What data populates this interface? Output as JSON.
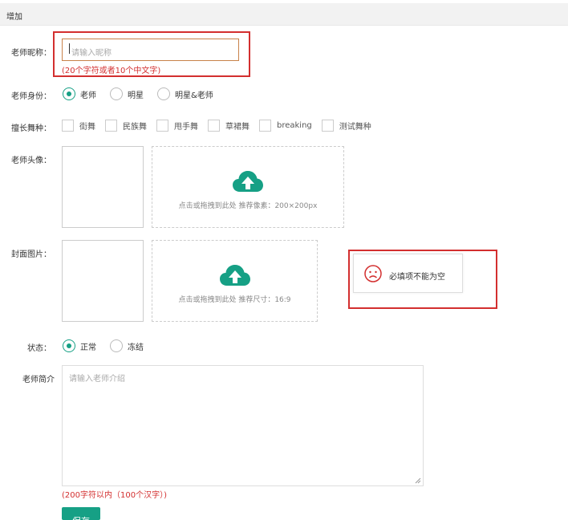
{
  "header": {
    "title": "增加"
  },
  "nickname": {
    "label": "老师昵称：",
    "placeholder": "请输入昵称",
    "hint": "(20个字符或者10个中文字)"
  },
  "identity": {
    "label": "老师身份：",
    "options": [
      "老师",
      "明星",
      "明星&老师"
    ],
    "selected": "老师"
  },
  "dance": {
    "label": "擅长舞种：",
    "options": [
      "街舞",
      "民族舞",
      "甩手舞",
      "草裙舞",
      "breaking",
      "测试舞种"
    ]
  },
  "avatar": {
    "label": "老师头像：",
    "upload_text": "点击或拖拽到此处 推荐像素：200×200px"
  },
  "cover": {
    "label": "封面图片：",
    "upload_text": "点击或拖拽到此处 推荐尺寸：16:9"
  },
  "toast": {
    "message": "必填项不能为空",
    "icon": "sad-face-icon"
  },
  "status": {
    "label": "状态：",
    "options": [
      "正常",
      "冻结"
    ],
    "selected": "正常"
  },
  "intro": {
    "label": "老师简介",
    "placeholder": "请输入老师介绍",
    "hint": "(200字符以内（100个汉字）)"
  },
  "save": {
    "label": "保存"
  },
  "colors": {
    "accent": "#16a085",
    "error": "#d32f2f",
    "input_border": "#c8824a"
  }
}
